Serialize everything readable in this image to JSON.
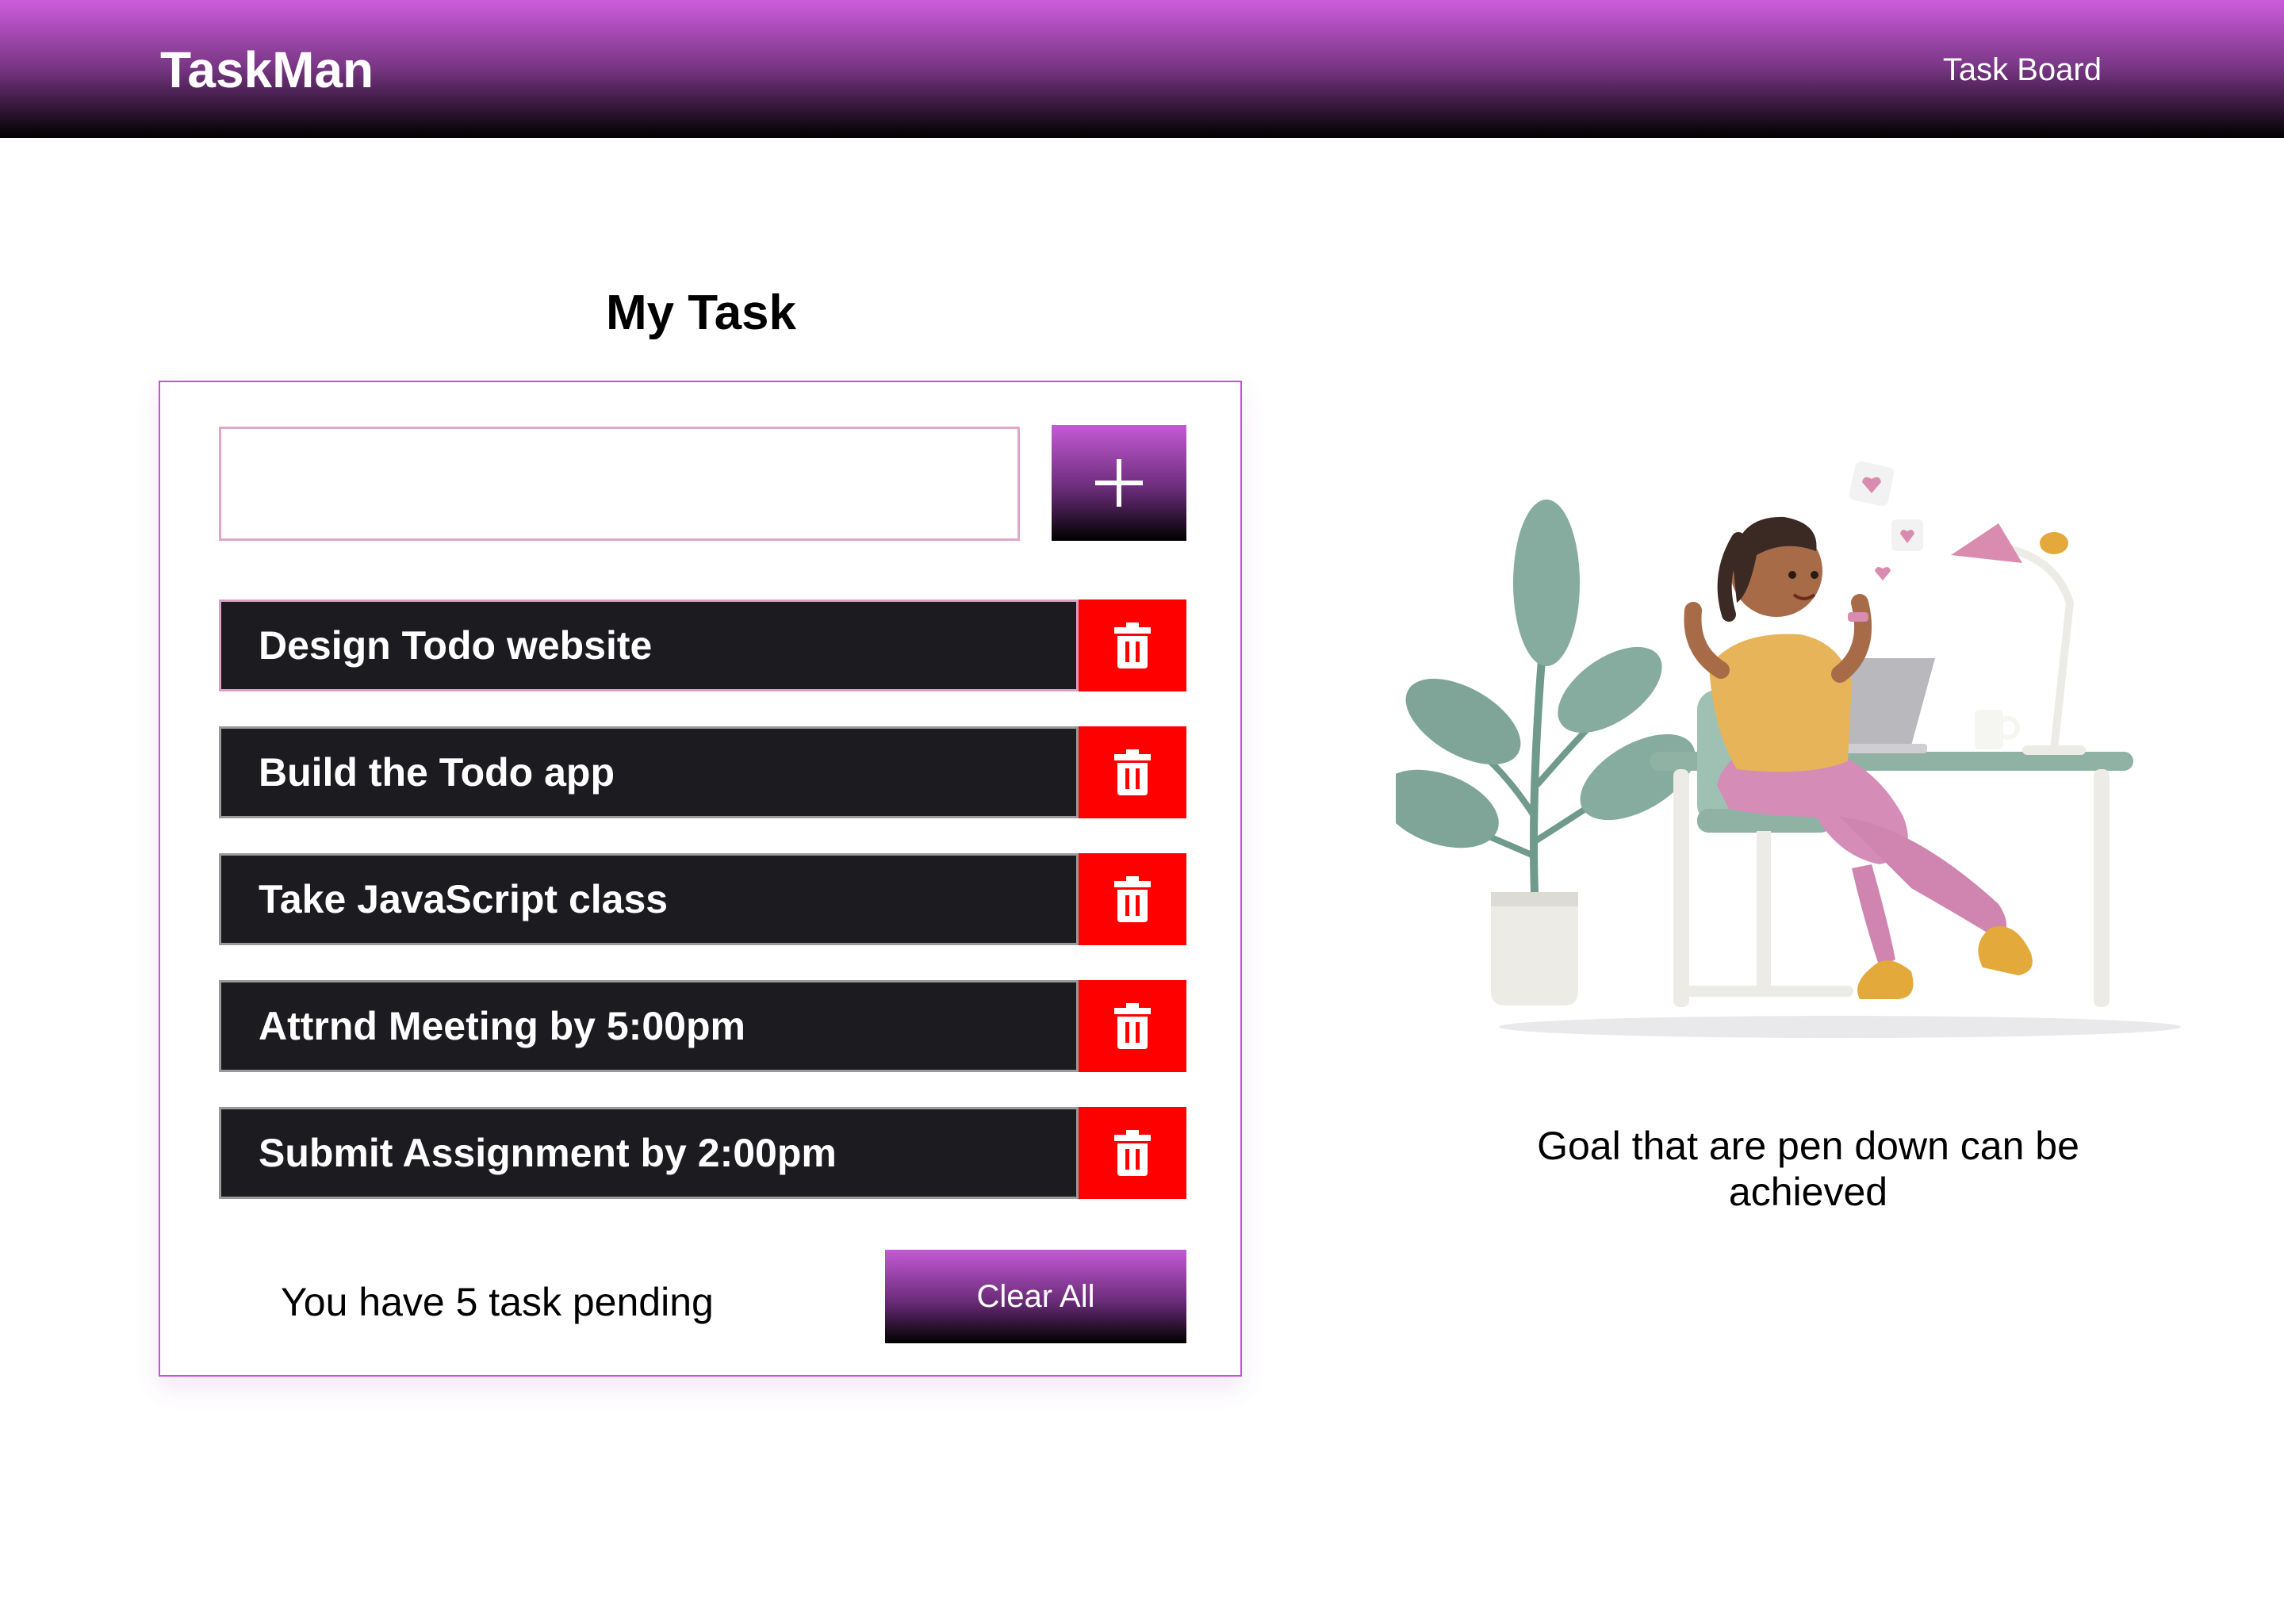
{
  "header": {
    "brand": "TaskMan",
    "nav_link": "Task Board"
  },
  "main": {
    "title": "My Task",
    "input": {
      "value": "",
      "placeholder": ""
    },
    "add_button_icon": "plus-icon",
    "tasks": [
      {
        "label": "Design Todo website"
      },
      {
        "label": "Build the Todo app"
      },
      {
        "label": "Take JavaScript class"
      },
      {
        "label": "Attrnd Meeting by 5:00pm"
      },
      {
        "label": "Submit Assignment by 2:00pm"
      }
    ],
    "delete_icon": "trash-icon",
    "pending_text": "You have 5 task pending",
    "clear_label": "Clear All"
  },
  "side": {
    "illustration": "woman-at-desk-illustration",
    "quote": "Goal that are pen down can be achieved"
  },
  "colors": {
    "accent": "#c45ad6",
    "task_bg": "#1c1b20",
    "delete_bg": "#ff0000",
    "card_border": "#c94fdc"
  }
}
